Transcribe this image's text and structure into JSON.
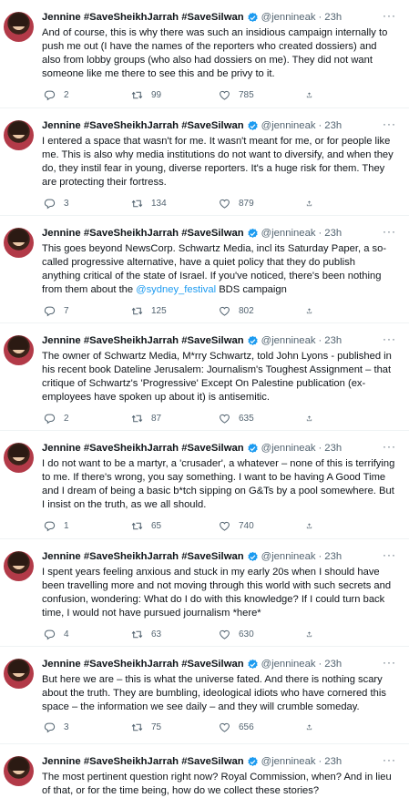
{
  "author": {
    "name": "Jennine #SaveSheikhJarrah #SaveSilwan",
    "handle": "@jennineak",
    "separator": "·",
    "time": "23h",
    "more": "···"
  },
  "tweets": [
    {
      "text": "And of course, this is why there was such an insidious campaign internally to push me out (I have the names of the reporters who created dossiers) and also from lobby groups (who also had dossiers on me). They did not want someone like me there to see this and be privy to it.",
      "replies": "2",
      "retweets": "99",
      "likes": "785"
    },
    {
      "text": "I entered a space that wasn't for me. It wasn't meant for me, or for people like me. This is also why media institutions do not want to diversify, and when they do, they instil fear in young, diverse reporters. It's a huge risk for them. They are protecting their fortress.",
      "replies": "3",
      "retweets": "134",
      "likes": "879"
    },
    {
      "text_before": "This goes beyond NewsCorp. Schwartz Media, incl its Saturday Paper, a so-called progressive alternative, have a quiet policy that they do publish anything critical of the state of Israel. If you've noticed, there's been nothing from them about the ",
      "mention": "@sydney_festival",
      "text_after": " BDS campaign",
      "replies": "7",
      "retweets": "125",
      "likes": "802"
    },
    {
      "text": "The owner of Schwartz Media, M*rry Schwartz, told John Lyons - published in his recent book Dateline Jerusalem: Journalism's Toughest Assignment – that critique of Schwartz's 'Progressive' Except On Palestine publication (ex-employees have spoken up about it) is antisemitic.",
      "replies": "2",
      "retweets": "87",
      "likes": "635"
    },
    {
      "text": "I do not want to be a martyr, a 'crusader', a whatever – none of this is terrifying to me. If there's wrong, you say something. I want to be having A Good Time and I dream of being a basic b*tch sipping on G&Ts by a pool somewhere. But I insist on the truth, as we all should.",
      "replies": "1",
      "retweets": "65",
      "likes": "740"
    },
    {
      "text": "I spent years feeling anxious and stuck in my early 20s when I should have been travelling more and not moving through this world with such secrets and confusion, wondering: What do I do with this knowledge? If I could turn back time, I would not have pursued journalism *here*",
      "replies": "4",
      "retweets": "63",
      "likes": "630"
    },
    {
      "text": "But here we are – this is what the universe fated. And there is nothing scary about the truth. They are bumbling, ideological idiots who have cornered this space – the information we see daily – and they will crumble someday.",
      "replies": "3",
      "retweets": "75",
      "likes": "656"
    },
    {
      "text": "The most pertinent question right now? Royal Commission, when? And in lieu of that, or for the time being, how do we collect these stories?"
    }
  ],
  "colors": {
    "accent": "#1d9bf0",
    "muted": "#536471",
    "text": "#0f1419"
  },
  "icons": [
    "reply-icon",
    "retweet-icon",
    "like-icon",
    "share-icon",
    "verified-badge-icon",
    "more-icon"
  ]
}
